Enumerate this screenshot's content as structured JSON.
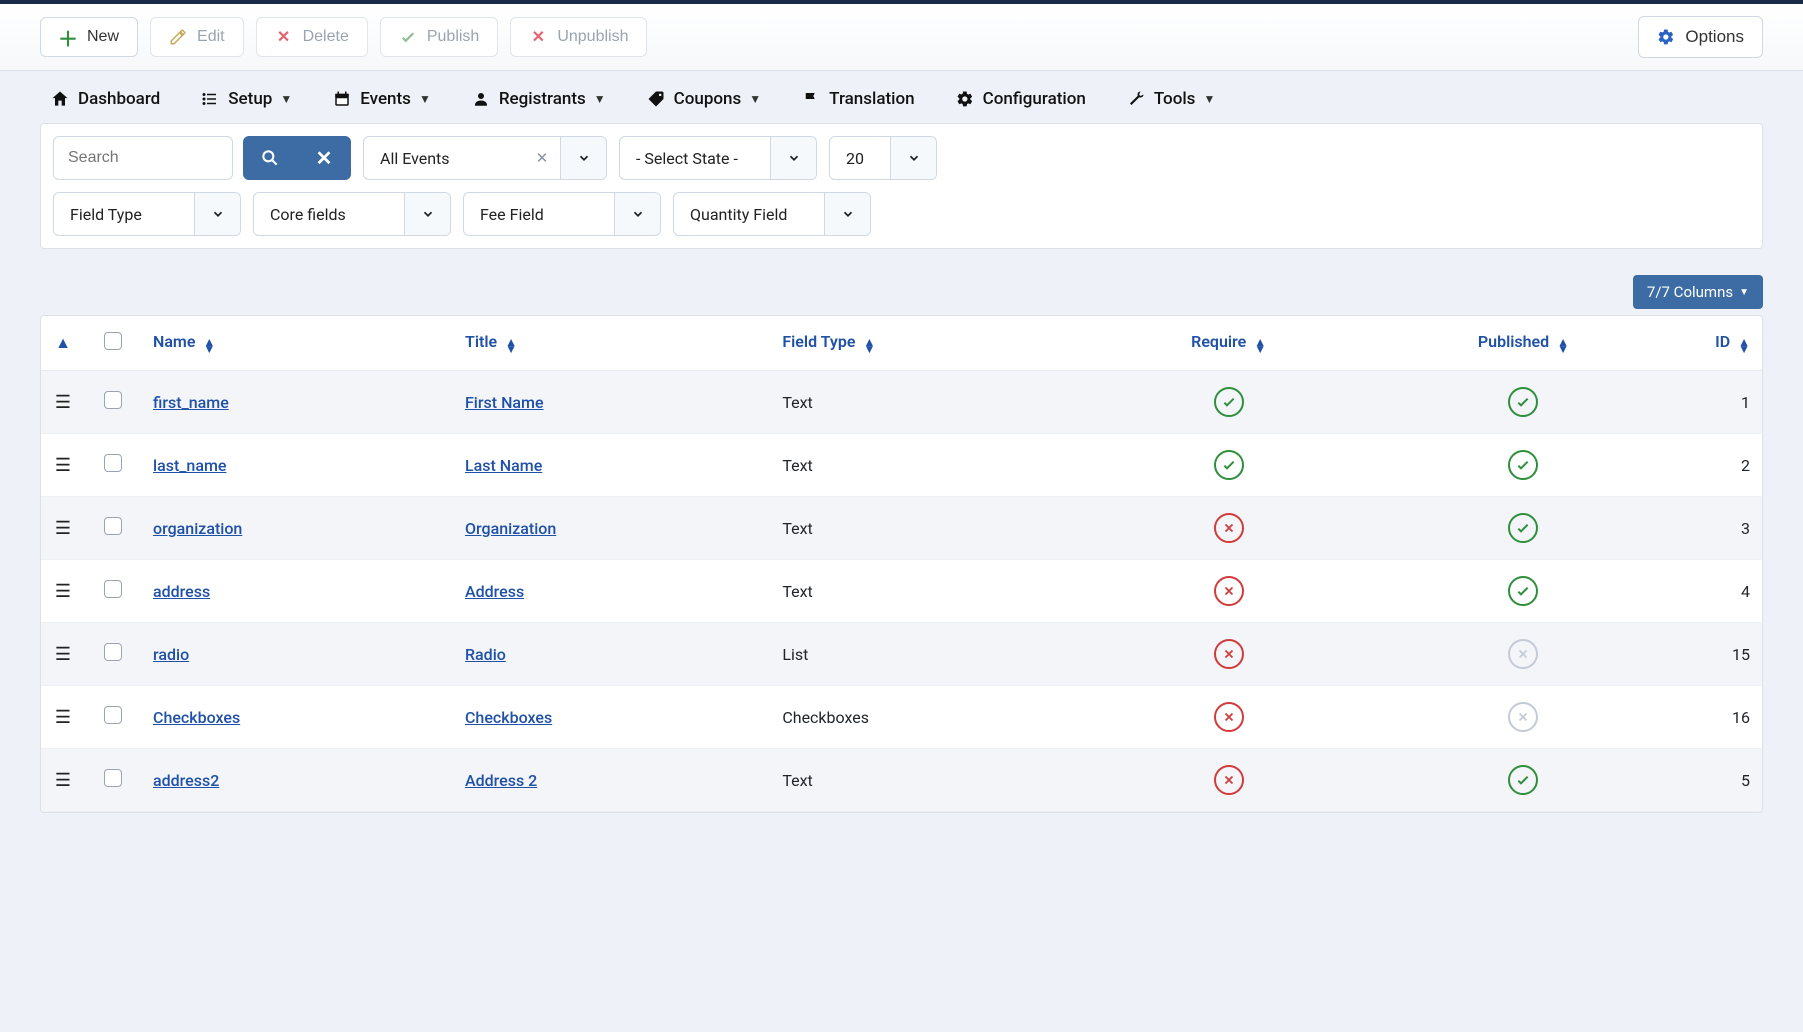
{
  "toolbar": {
    "new": "New",
    "edit": "Edit",
    "delete": "Delete",
    "publish": "Publish",
    "unpublish": "Unpublish",
    "options": "Options"
  },
  "menu": {
    "dashboard": "Dashboard",
    "setup": "Setup",
    "events": "Events",
    "registrants": "Registrants",
    "coupons": "Coupons",
    "translation": "Translation",
    "configuration": "Configuration",
    "tools": "Tools"
  },
  "filters": {
    "search_placeholder": "Search",
    "all_events": "All Events",
    "select_state": "- Select State -",
    "limit": "20",
    "field_type": "Field Type",
    "core_fields": "Core fields",
    "fee_field": "Fee Field",
    "quantity_field": "Quantity Field"
  },
  "columns_pill": "7/7 Columns",
  "headers": {
    "name": "Name",
    "title": "Title",
    "field_type": "Field Type",
    "require": "Require",
    "published": "Published",
    "id": "ID"
  },
  "rows": [
    {
      "name": "first_name",
      "title": "First Name",
      "type": "Text",
      "require": true,
      "published": "yes",
      "id": 1
    },
    {
      "name": "last_name",
      "title": "Last Name",
      "type": "Text",
      "require": true,
      "published": "yes",
      "id": 2
    },
    {
      "name": "organization",
      "title": "Organization",
      "type": "Text",
      "require": false,
      "published": "yes",
      "id": 3
    },
    {
      "name": "address",
      "title": "Address",
      "type": "Text",
      "require": false,
      "published": "yes",
      "id": 4
    },
    {
      "name": "radio",
      "title": "Radio",
      "type": "List",
      "require": false,
      "published": "muted",
      "id": 15
    },
    {
      "name": "Checkboxes",
      "title": "Checkboxes",
      "type": "Checkboxes",
      "require": false,
      "published": "muted",
      "id": 16
    },
    {
      "name": "address2",
      "title": "Address 2",
      "type": "Text",
      "require": false,
      "published": "yes",
      "id": 5
    }
  ]
}
